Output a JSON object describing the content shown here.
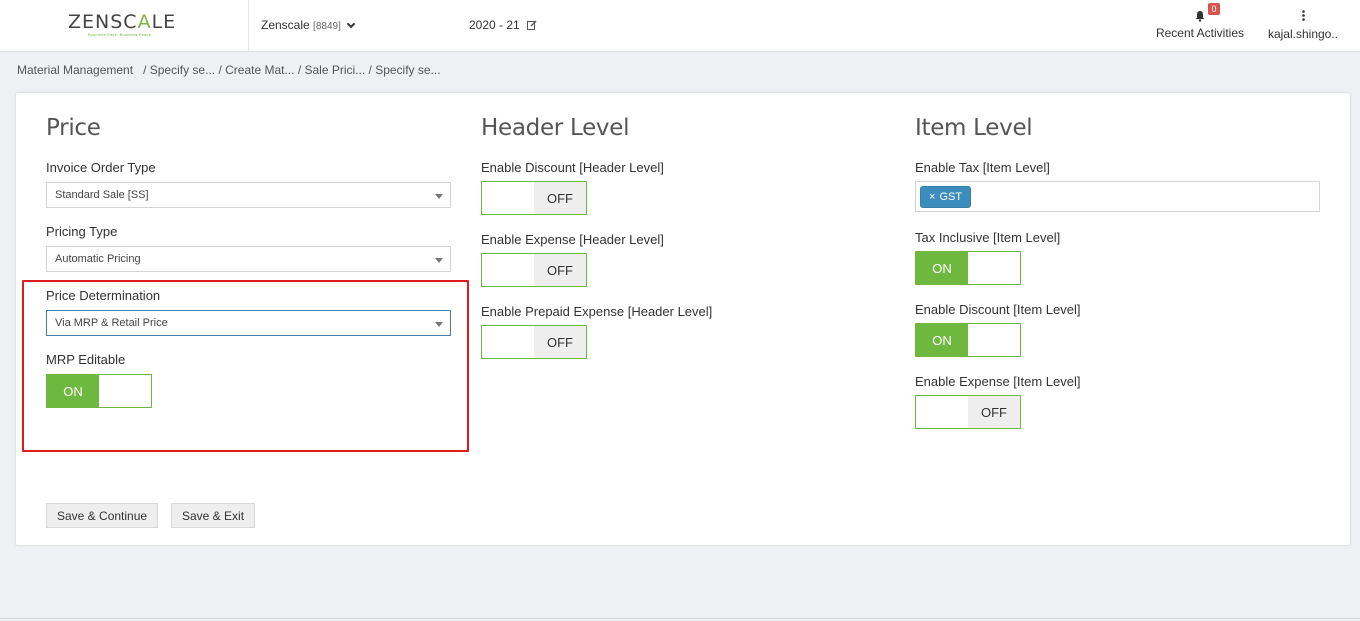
{
  "header": {
    "logo_text_a": "ZENSC",
    "logo_text_b": "A",
    "logo_text_c": "LE",
    "logo_tagline": "Business Ease. Business Peace.",
    "company_name": "Zenscale",
    "company_code": "[8849]",
    "fiscal_year": "2020 - 21",
    "recent_label": "Recent Activities",
    "notification_count": "0",
    "user_name": "kajal.shingo.."
  },
  "breadcrumb": {
    "items": [
      "Material Management",
      "/ Specify se...",
      "/ Create Mat...",
      "/ Sale Prici...",
      "/ Specify se..."
    ]
  },
  "price": {
    "title": "Price",
    "invoice_order_type_label": "Invoice Order Type",
    "invoice_order_type_value": "Standard Sale [SS]",
    "pricing_type_label": "Pricing Type",
    "pricing_type_value": "Automatic Pricing",
    "price_determination_label": "Price Determination",
    "price_determination_value": "Via MRP & Retail Price",
    "mrp_editable_label": "MRP Editable",
    "mrp_editable_state": "ON"
  },
  "header_level": {
    "title": "Header Level",
    "enable_discount_label": "Enable Discount [Header Level]",
    "enable_discount_state": "OFF",
    "enable_expense_label": "Enable Expense [Header Level]",
    "enable_expense_state": "OFF",
    "enable_prepaid_label": "Enable Prepaid Expense [Header Level]",
    "enable_prepaid_state": "OFF"
  },
  "item_level": {
    "title": "Item Level",
    "enable_tax_label": "Enable Tax [Item Level]",
    "tax_chip": "GST",
    "tax_chip_remove": "×",
    "tax_inclusive_label": "Tax Inclusive [Item Level]",
    "tax_inclusive_state": "ON",
    "enable_discount_label": "Enable Discount [Item Level]",
    "enable_discount_state": "ON",
    "enable_expense_label": "Enable Expense [Item Level]",
    "enable_expense_state": "OFF"
  },
  "actions": {
    "save_continue": "Save & Continue",
    "save_exit": "Save & Exit"
  },
  "colors": {
    "accent_green": "#6fb83f",
    "chip_blue": "#3c8dbc",
    "highlight_red": "#e01b1b",
    "badge_red": "#d9534f"
  }
}
